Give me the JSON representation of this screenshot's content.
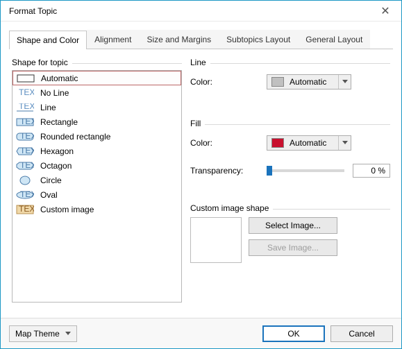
{
  "window": {
    "title": "Format Topic"
  },
  "tabs": [
    {
      "label": "Shape and Color",
      "active": true
    },
    {
      "label": "Alignment"
    },
    {
      "label": "Size and Margins"
    },
    {
      "label": "Subtopics Layout"
    },
    {
      "label": "General Layout"
    }
  ],
  "shape_group": {
    "title": "Shape for topic",
    "items": [
      {
        "label": "Automatic",
        "selected": true
      },
      {
        "label": "No Line"
      },
      {
        "label": "Line"
      },
      {
        "label": "Rectangle"
      },
      {
        "label": "Rounded rectangle"
      },
      {
        "label": "Hexagon"
      },
      {
        "label": "Octagon"
      },
      {
        "label": "Circle"
      },
      {
        "label": "Oval"
      },
      {
        "label": "Custom image"
      }
    ]
  },
  "line": {
    "title": "Line",
    "color_label": "Color:",
    "color_value": "Automatic",
    "swatch": "#c0c0c0"
  },
  "fill": {
    "title": "Fill",
    "color_label": "Color:",
    "color_value": "Automatic",
    "swatch": "#c8102e",
    "transparency_label": "Transparency:",
    "transparency_value": "0 %"
  },
  "custom": {
    "title": "Custom image shape",
    "select_btn": "Select Image...",
    "save_btn": "Save Image..."
  },
  "footer": {
    "map_theme": "Map Theme",
    "ok": "OK",
    "cancel": "Cancel"
  }
}
